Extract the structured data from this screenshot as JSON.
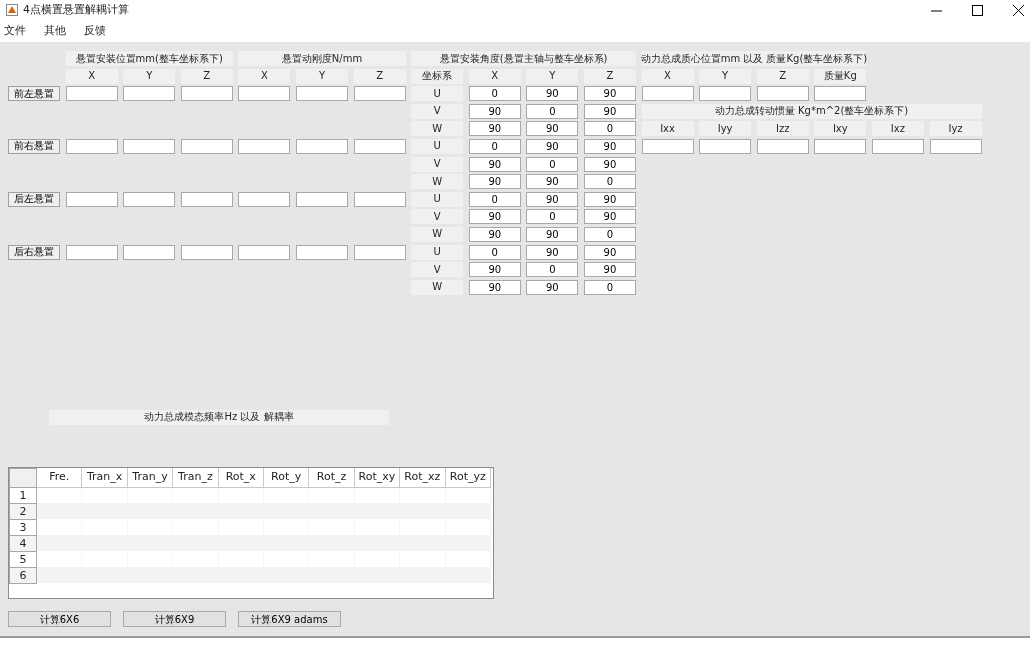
{
  "window": {
    "title": "4点横置悬置解耦计算"
  },
  "menu": [
    "文件",
    "其他",
    "反馈"
  ],
  "position": {
    "title": "悬置安装位置mm(整车坐标系下)",
    "axes": [
      "X",
      "Y",
      "Z"
    ]
  },
  "stiffness": {
    "title": "悬置动刚度N/mm",
    "axes": [
      "X",
      "Y",
      "Z"
    ]
  },
  "angle": {
    "title": "悬置安装角度(悬置主轴与整车坐标系)",
    "frame_label": "坐标系",
    "axes": [
      "X",
      "Y",
      "Z"
    ],
    "rows": [
      {
        "axis": "U",
        "values": [
          "0",
          "90",
          "90"
        ]
      },
      {
        "axis": "V",
        "values": [
          "90",
          "0",
          "90"
        ]
      },
      {
        "axis": "W",
        "values": [
          "90",
          "90",
          "0"
        ]
      },
      {
        "axis": "U",
        "values": [
          "0",
          "90",
          "90"
        ]
      },
      {
        "axis": "V",
        "values": [
          "90",
          "0",
          "90"
        ]
      },
      {
        "axis": "W",
        "values": [
          "90",
          "90",
          "0"
        ]
      },
      {
        "axis": "U",
        "values": [
          "0",
          "90",
          "90"
        ]
      },
      {
        "axis": "V",
        "values": [
          "90",
          "0",
          "90"
        ]
      },
      {
        "axis": "W",
        "values": [
          "90",
          "90",
          "0"
        ]
      },
      {
        "axis": "U",
        "values": [
          "0",
          "90",
          "90"
        ]
      },
      {
        "axis": "V",
        "values": [
          "90",
          "0",
          "90"
        ]
      },
      {
        "axis": "W",
        "values": [
          "90",
          "90",
          "0"
        ]
      }
    ]
  },
  "mounts": [
    "前左悬置",
    "前右悬置",
    "后左悬置",
    "后右悬置"
  ],
  "cg": {
    "title": "动力总成质心位置mm 以及 质量Kg(整车坐标系下)",
    "labels": [
      "X",
      "Y",
      "Z",
      "质量Kg"
    ]
  },
  "inertia": {
    "title": "动力总成转动惯量 Kg*m^2(整车坐标系下)",
    "labels": [
      "Ixx",
      "Iyy",
      "Izz",
      "Ixy",
      "Ixz",
      "Iyz"
    ]
  },
  "modal": {
    "title": "动力总成模态频率Hz 以及 解耦率",
    "columns": [
      "Fre.",
      "Tran_x",
      "Tran_y",
      "Tran_z",
      "Rot_x",
      "Rot_y",
      "Rot_z",
      "Rot_xy",
      "Rot_xz",
      "Rot_yz"
    ],
    "rows": [
      "1",
      "2",
      "3",
      "4",
      "5",
      "6"
    ]
  },
  "buttons": [
    "计算6X6",
    "计算6X9",
    "计算6X9 adams"
  ]
}
